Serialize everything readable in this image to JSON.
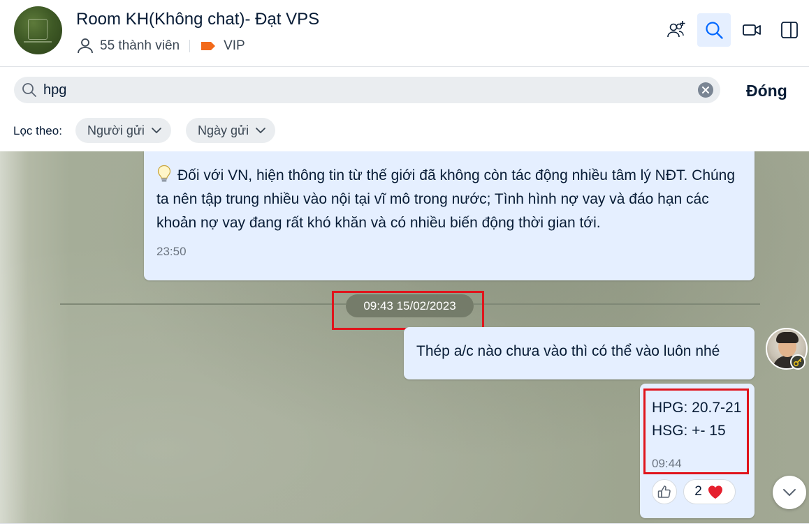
{
  "header": {
    "title": "Room KH(Không chat)- Đạt VPS",
    "members": "55 thành viên",
    "tag_label": "VIP",
    "tag_color": "#f26a1b",
    "icons": [
      "add-member-icon",
      "search-icon",
      "video-call-icon",
      "toggle-panel-icon"
    ]
  },
  "search": {
    "value": "hpg",
    "close_label": "Đóng",
    "filter_label": "Lọc theo:",
    "filters": [
      {
        "label": "Người gửi"
      },
      {
        "label": "Ngày gửi"
      }
    ]
  },
  "messages": [
    {
      "text": "Đối với VN, hiện thông tin từ thế giới đã không còn tác động nhiều tâm lý NĐT. Chúng ta nên tập trung nhiều vào nội tại vĩ mô trong nước; Tình hình nợ vay và đáo hạn các khoản nợ vay đang rất khó khăn và có nhiều biến động thời gian tới.",
      "time": "23:50"
    },
    {
      "text": "Thép a/c nào chưa vào thì có thể vào luôn nhé"
    },
    {
      "line1": "HPG: 20.7-21",
      "line2": "HSG: +- 15",
      "time": "09:44",
      "heart_count": "2"
    }
  ],
  "date_separator": "09:43 15/02/2023",
  "colors": {
    "bubble": "#e5efff",
    "highlight_box": "#e0141c",
    "active_button": "#e5efff",
    "accent": "#0068ff"
  }
}
